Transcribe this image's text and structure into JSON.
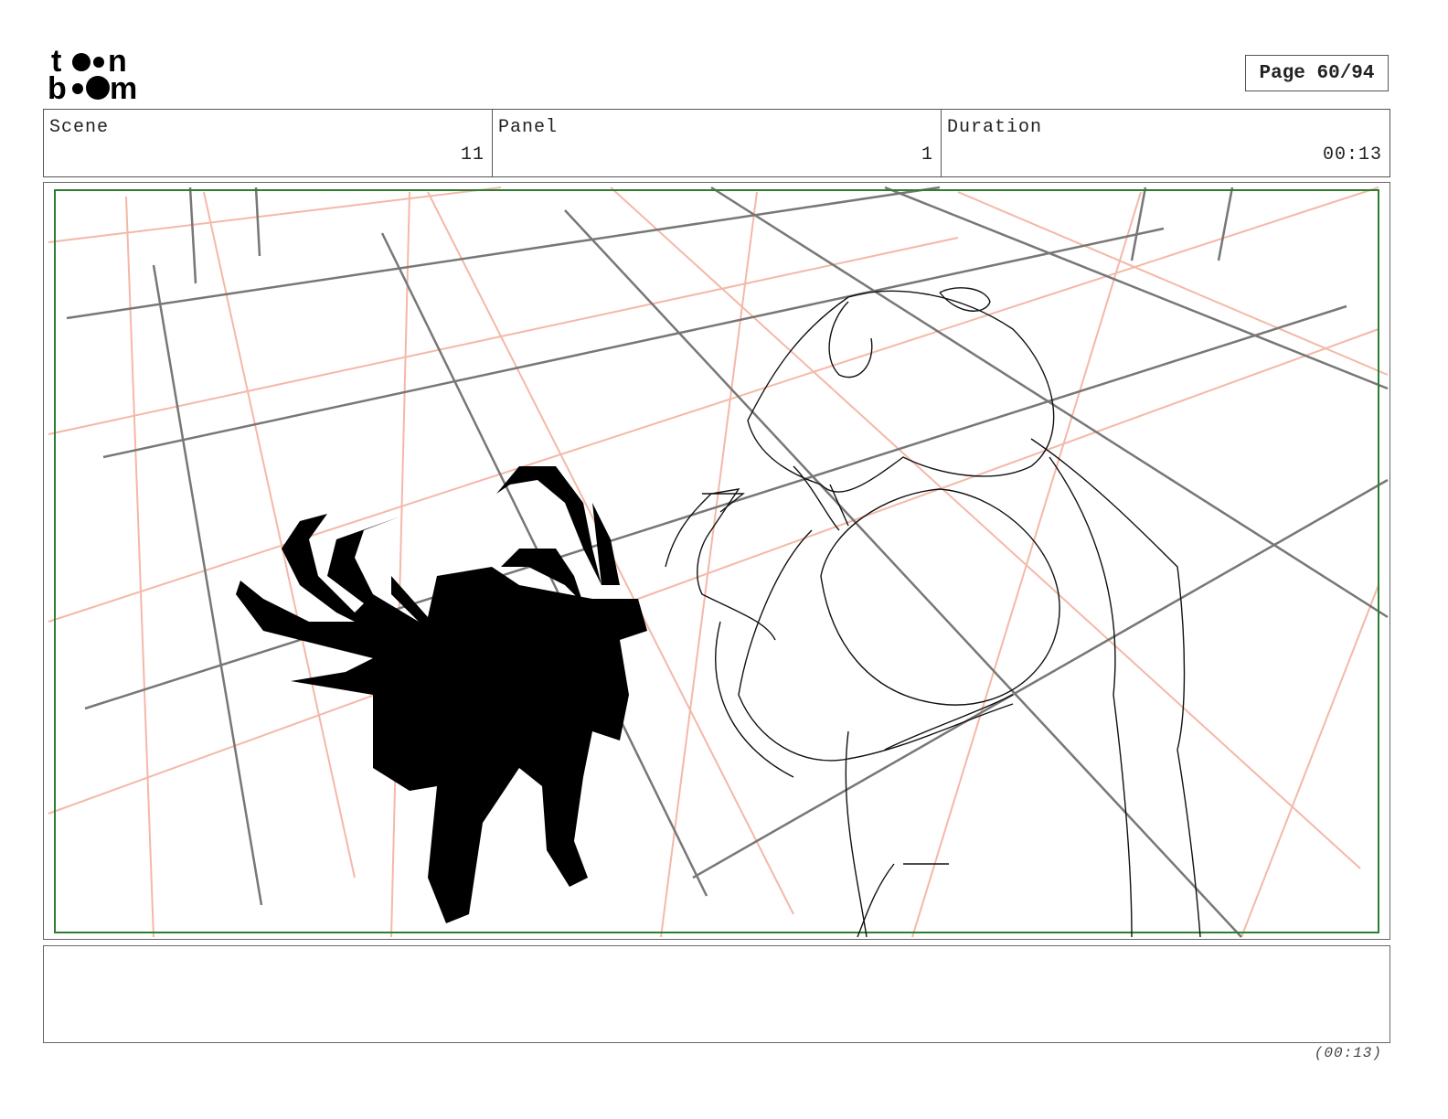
{
  "logo": {
    "text": "toon boom"
  },
  "page": {
    "label": "Page 60/94"
  },
  "header": {
    "scene": {
      "label": "Scene",
      "value": "11"
    },
    "panel": {
      "label": "Panel",
      "value": "1"
    },
    "duration": {
      "label": "Duration",
      "value": "00:13"
    }
  },
  "notes": {
    "text": ""
  },
  "footer": {
    "duration": "(00:13)"
  },
  "colors": {
    "safe_frame": "#2e7d32",
    "grid_pink": "#f4b8a8",
    "grid_gray": "#777777"
  }
}
